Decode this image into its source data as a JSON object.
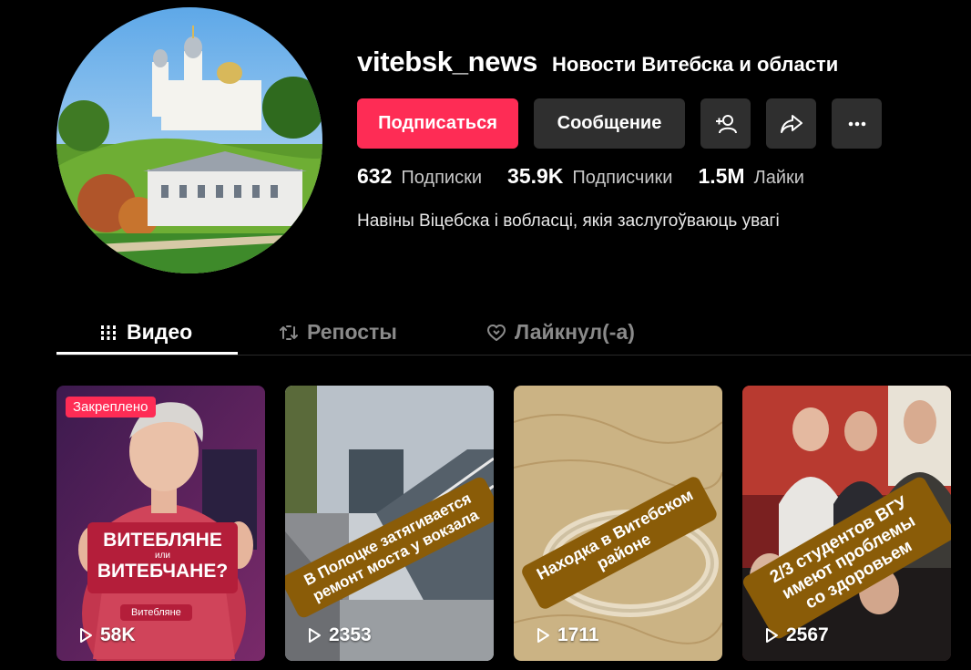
{
  "profile": {
    "username": "vitebsk_news",
    "nickname": "Новости Витебска и области",
    "bio": "Навіны Віцебска і вобласці, якія заслугоўваюць увагі"
  },
  "actions": {
    "follow_label": "Подписаться",
    "message_label": "Сообщение",
    "add_friend_icon": "add-user-icon",
    "share_icon": "share-icon",
    "more_icon": "more-icon"
  },
  "stats": {
    "following": {
      "value": "632",
      "label": "Подписки"
    },
    "followers": {
      "value": "35.9K",
      "label": "Подписчики"
    },
    "likes": {
      "value": "1.5M",
      "label": "Лайки"
    }
  },
  "tabs": [
    {
      "label": "Видео",
      "icon": "grid-icon",
      "active": true
    },
    {
      "label": "Репосты",
      "icon": "repost-icon",
      "active": false
    },
    {
      "label": "Лайкнул(-а)",
      "icon": "liked-icon",
      "active": false
    }
  ],
  "videos": [
    {
      "views": "58K",
      "pinned_label": "Закреплено",
      "overlay": [
        "ВИТЕБЛЯНЕ",
        "или",
        "ВИТЕБЧАНЕ?"
      ],
      "sub": "Витебляне"
    },
    {
      "views": "2353",
      "caption": [
        "В Полоцке затягивается",
        "ремонт моста у вокзала"
      ]
    },
    {
      "views": "1711",
      "caption": [
        "Находка в Витебском",
        "районе"
      ]
    },
    {
      "views": "2567",
      "caption": [
        "2/3 студентов ВГУ",
        "имеют проблемы",
        "со здоровьем"
      ]
    }
  ],
  "colors": {
    "accent": "#fe2c55",
    "button_dark": "#2f2f2f",
    "caption_band": "#8a5c08"
  }
}
